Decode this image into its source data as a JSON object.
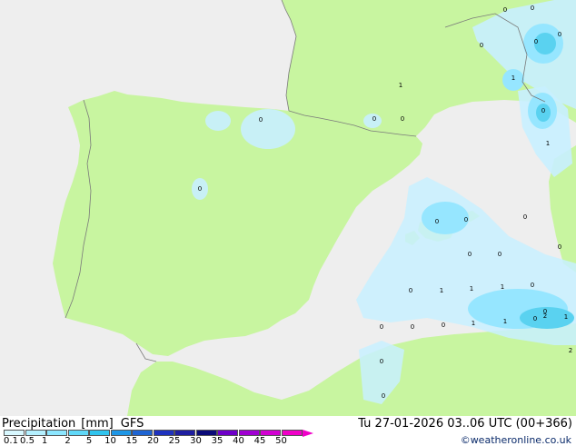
{
  "title": {
    "product": "Precipitation",
    "unit": "[mm]",
    "model": "GFS"
  },
  "valid_time": "Tu 27-01-2026 03..06 UTC (00+366)",
  "credit": "©weatheronline.co.uk",
  "colors": {
    "sea": "#eeeeee",
    "land": "#c8f5a0",
    "precip_light": "#c8f0ff",
    "precip_mid": "#96e6ff",
    "precip_strong": "#5ad2f0",
    "border": "#7a7a7a"
  },
  "legend": {
    "swatches": [
      "#d8f8ff",
      "#b4f0ff",
      "#8ce6ff",
      "#60d8f8",
      "#30c4ee",
      "#1e96e6",
      "#1e64d2",
      "#1e32be",
      "#1e1ea0",
      "#0a0a78",
      "#6e00c8",
      "#a000d2",
      "#d200d2",
      "#f000c8"
    ],
    "ticks": [
      "0.1",
      "0.5",
      "1",
      "2",
      "5",
      "10",
      "15",
      "20",
      "25",
      "30",
      "35",
      "40",
      "45",
      "50"
    ]
  },
  "values": [
    {
      "text": "0"
    },
    {
      "text": "0"
    },
    {
      "text": "0"
    },
    {
      "text": "0"
    },
    {
      "text": "0"
    },
    {
      "text": "0"
    },
    {
      "text": "1"
    },
    {
      "text": "1"
    },
    {
      "text": "1"
    },
    {
      "text": "0"
    },
    {
      "text": "0"
    },
    {
      "text": "0"
    },
    {
      "text": "0"
    },
    {
      "text": "0"
    },
    {
      "text": "0"
    },
    {
      "text": "0"
    },
    {
      "text": "0"
    },
    {
      "text": "1"
    },
    {
      "text": "0"
    },
    {
      "text": "0"
    },
    {
      "text": "1"
    },
    {
      "text": "0"
    },
    {
      "text": "0"
    },
    {
      "text": "1"
    },
    {
      "text": "1"
    },
    {
      "text": "0"
    },
    {
      "text": "0"
    },
    {
      "text": "0"
    },
    {
      "text": "0"
    },
    {
      "text": "1"
    },
    {
      "text": "1"
    },
    {
      "text": "2"
    },
    {
      "text": "2"
    },
    {
      "text": "0"
    },
    {
      "text": "0"
    },
    {
      "text": "0"
    }
  ]
}
